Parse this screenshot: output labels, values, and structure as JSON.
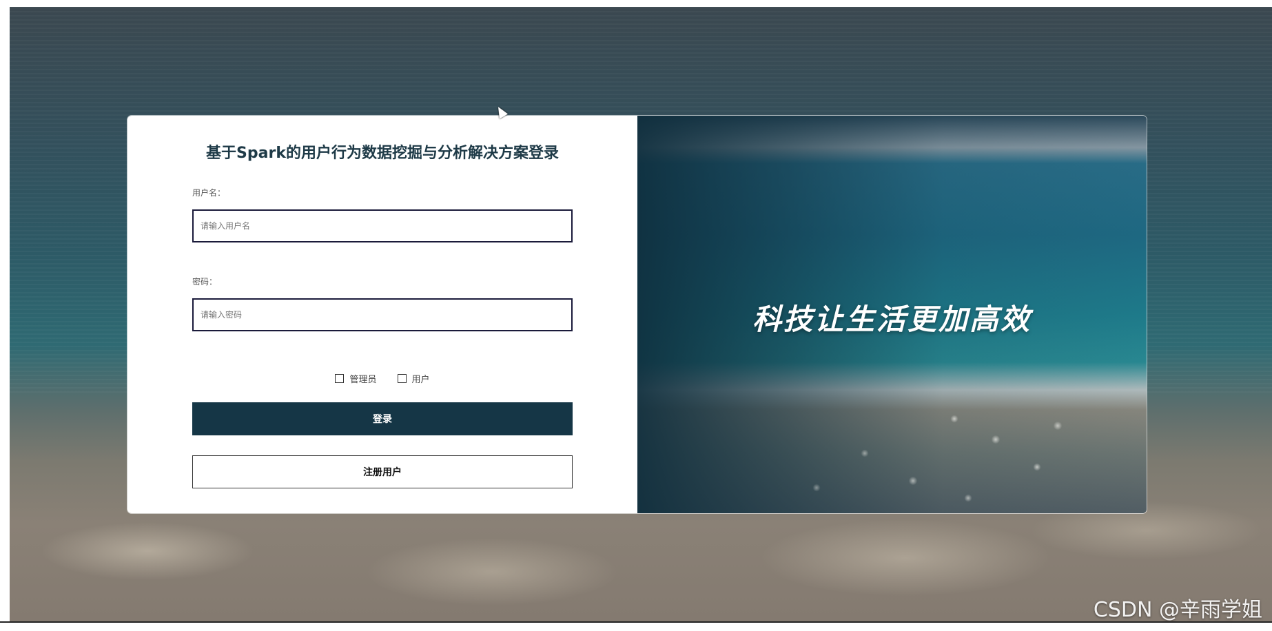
{
  "login": {
    "title": "基于Spark的用户行为数据挖掘与分析解决方案登录",
    "username_label": "用户名：",
    "username_placeholder": "请输入用户名",
    "password_label": "密码：",
    "password_placeholder": "请输入密码",
    "roles": [
      {
        "label": "管理员"
      },
      {
        "label": "用户"
      }
    ],
    "login_button": "登录",
    "register_button": "注册用户"
  },
  "hero": {
    "slogan": "科技让生活更加高效"
  },
  "watermark": "CSDN @辛雨学姐",
  "colors": {
    "primary": "#153646",
    "title": "#1e3a47"
  }
}
